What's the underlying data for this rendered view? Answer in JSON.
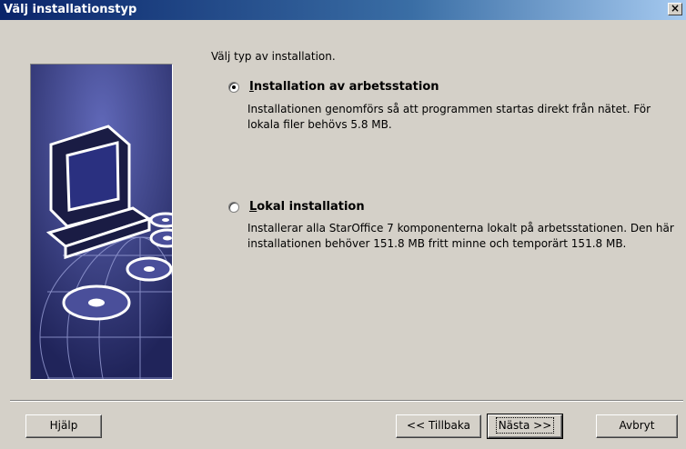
{
  "window": {
    "title": "Välj installationstyp",
    "close_label": "×"
  },
  "prompt": "Välj typ av installation.",
  "options": [
    {
      "label_accel": "I",
      "label_rest": "nstallation av arbetsstation",
      "selected": true,
      "desc": "Installationen genomförs så att programmen startas direkt från nätet. För lokala filer behövs 5.8 MB."
    },
    {
      "label_accel": "L",
      "label_rest": "okal installation",
      "selected": false,
      "desc": "Installerar alla StarOffice 7 komponenterna lokalt på arbetsstationen. Den här installationen behöver 151.8 MB fritt minne och temporärt 151.8 MB."
    }
  ],
  "buttons": {
    "help": "Hjälp",
    "back": "<< Tillbaka",
    "next": "Nästa >>",
    "cancel": "Avbryt"
  }
}
